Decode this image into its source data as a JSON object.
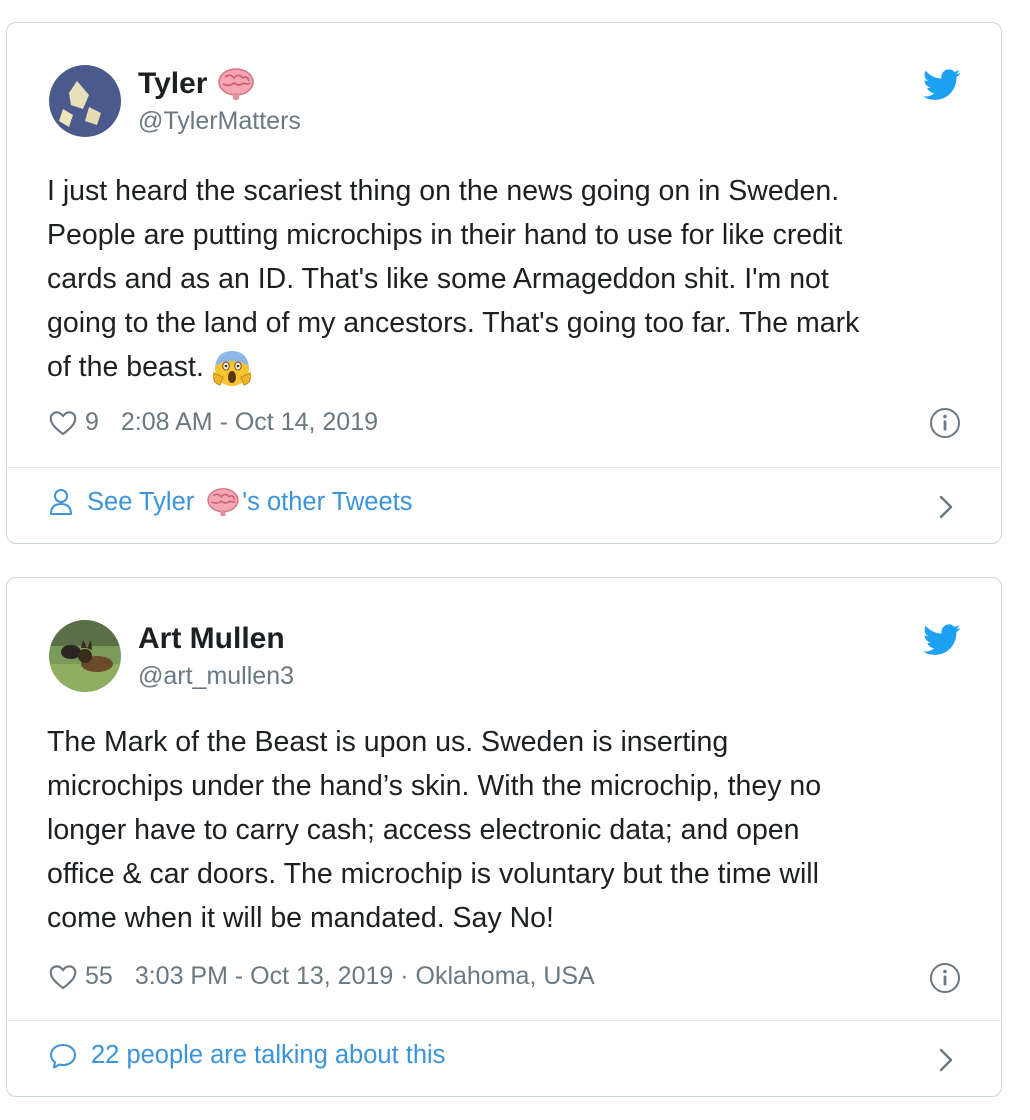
{
  "tweets": [
    {
      "name": "Tyler",
      "name_emoji": "brain-icon",
      "handle": "@TylerMatters",
      "text": "I just heard the scariest thing on the news going on in Sweden.\nPeople are putting microchips in their hand to use for like credit\ncards and as an ID. That's like some Armageddon shit. I'm not\ngoing to the land of my ancestors. That's going too far. The mark\nof the beast.",
      "text_emoji": "screaming-face-icon",
      "likes": "9",
      "timestamp": "2:08 AM - Oct 14, 2019",
      "footer_prefix": "See Tyler",
      "footer_suffix": "'s other Tweets"
    },
    {
      "name": "Art Mullen",
      "handle": "@art_mullen3",
      "text": "The Mark of the Beast is upon us. Sweden is inserting\nmicrochips under the hand’s skin. With the microchip, they no\nlonger have to carry cash; access electronic data; and open\noffice & car doors. The microchip is voluntary but the time will\ncome when it will be mandated. Say No!",
      "likes": "55",
      "timestamp": "3:03 PM - Oct 13, 2019 · Oklahoma, USA",
      "footer": "22 people are talking about this"
    }
  ],
  "colors": {
    "link": "#3b94d9",
    "muted": "#697882",
    "bird": "#1da1f2",
    "border": "#ccd6dd"
  }
}
